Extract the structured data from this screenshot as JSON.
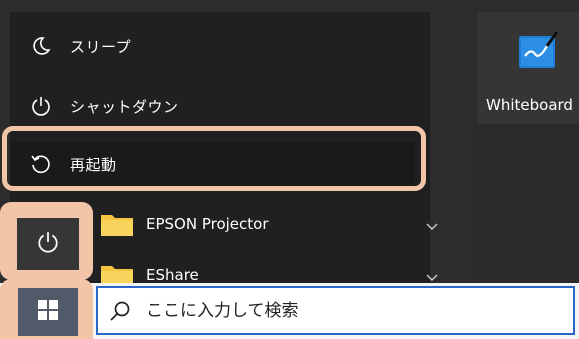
{
  "power_menu": {
    "items": [
      {
        "label": "スリープ",
        "icon": "moon-icon"
      },
      {
        "label": "シャットダウン",
        "icon": "power-icon"
      },
      {
        "label": "再起動",
        "icon": "restart-icon"
      }
    ]
  },
  "app_list": {
    "folders": [
      {
        "label": "EPSON Projector",
        "icon": "folder-icon"
      },
      {
        "label": "EShare",
        "icon": "folder-icon"
      }
    ]
  },
  "tiles": [
    {
      "label": "Whiteboard",
      "icon": "whiteboard-icon"
    }
  ],
  "taskbar": {
    "search_placeholder": "ここに入力して検索"
  },
  "colors": {
    "highlight": "#f2c4a8",
    "menu_bg": "#202020",
    "accent": "#2a67c6"
  }
}
